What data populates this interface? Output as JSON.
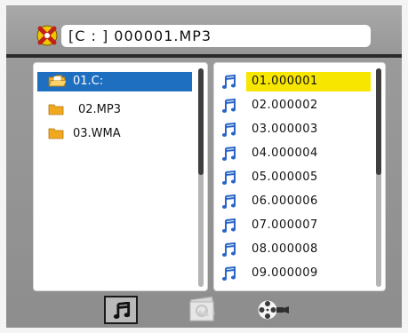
{
  "header": {
    "disc_icon": "disc-x-icon",
    "path": "[C : ]   000001.MP3"
  },
  "folders": [
    {
      "label": "01.C:",
      "icon": "open-folder-icon",
      "selected": true
    },
    {
      "label": "02.MP3",
      "icon": "folder-icon",
      "selected": false
    },
    {
      "label": "03.WMA",
      "icon": "folder-icon",
      "selected": false
    }
  ],
  "files": [
    {
      "label": "01.000001",
      "icon": "music-note-icon",
      "selected": true
    },
    {
      "label": "02.000002",
      "icon": "music-note-icon",
      "selected": false
    },
    {
      "label": "03.000003",
      "icon": "music-note-icon",
      "selected": false
    },
    {
      "label": "04.000004",
      "icon": "music-note-icon",
      "selected": false
    },
    {
      "label": "05.000005",
      "icon": "music-note-icon",
      "selected": false
    },
    {
      "label": "06.000006",
      "icon": "music-note-icon",
      "selected": false
    },
    {
      "label": "07.000007",
      "icon": "music-note-icon",
      "selected": false
    },
    {
      "label": "08.000008",
      "icon": "music-note-icon",
      "selected": false
    },
    {
      "label": "09.000009",
      "icon": "music-note-icon",
      "selected": false
    }
  ],
  "modes": [
    {
      "name": "music-mode",
      "icon": "music-note-icon",
      "active": true
    },
    {
      "name": "photo-mode",
      "icon": "photo-icon",
      "active": false
    },
    {
      "name": "video-mode",
      "icon": "film-reel-icon",
      "active": false
    }
  ],
  "colors": {
    "selection_blue": "#1e6fbf",
    "selection_yellow": "#f7e600",
    "note_blue": "#2a66c8",
    "frame_gray": "#9a9a9a"
  }
}
